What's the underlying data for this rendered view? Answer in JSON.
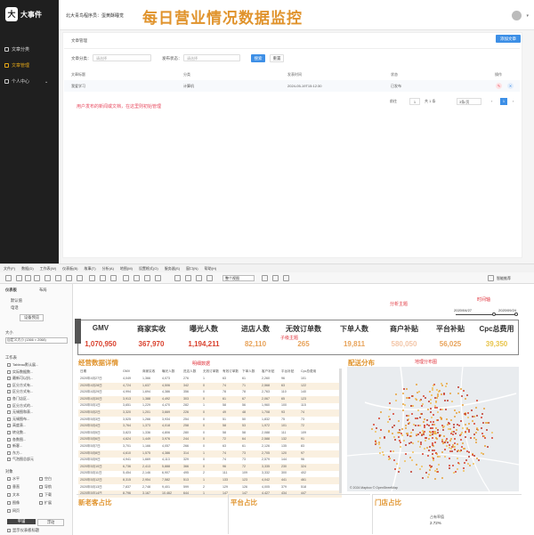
{
  "admin": {
    "logo_text": "大事件",
    "sidebar": [
      {
        "label": "文章分类"
      },
      {
        "label": "文章管理"
      },
      {
        "label": "个人中心"
      }
    ],
    "header_title": "北大青鸟程序员：蛋黄酥睡觉",
    "card_title": "文章管理",
    "add_button": "添加文章",
    "filter": {
      "category_label": "文章分类：",
      "category_placeholder": "请选择",
      "status_label": "发布状态：",
      "status_placeholder": "请选择",
      "search_button": "搜索",
      "reset_button": "重置"
    },
    "columns": [
      "文章标题",
      "分类",
      "发表时间",
      "状态",
      "操作"
    ],
    "rows": [
      {
        "title": "我爱学习",
        "category": "计算机",
        "time": "2024-05-19T15:12:30",
        "status": "已发布"
      }
    ],
    "note": "用户发布的新闻或文档，在这里则初始管理",
    "pagination": {
      "total": "共 1 条",
      "page_size": "3条/页",
      "jump_label": "前往",
      "page": "1",
      "current": "1"
    }
  },
  "tableau": {
    "menu": [
      "文件(F)",
      "数据(D)",
      "工作表(W)",
      "仪表板(B)",
      "故事(T)",
      "分析(A)",
      "地图(M)",
      "设置格式(O)",
      "服务器(S)",
      "窗口(N)",
      "帮助(H)"
    ],
    "toolbar_view": "整个视图",
    "smart_recommend": "智能推荐",
    "left": {
      "tab1": "仪表板",
      "tab2": "布局",
      "device_preview": "默认值",
      "device_sub": "电话",
      "device_button": "设备预览",
      "size_label": "大小",
      "size_value": "自定义大小 (1366 × 2068)",
      "sheets_label": "工作表",
      "sheets": [
        "Tableau默认展...",
        "实际数据数...",
        "最新可以抗...",
        "区分方式有...",
        "区分方式有...",
        "各门店区...",
        "区分方式的...",
        "无锡图和表...",
        "无锡图布...",
        "高度表...",
        "转化数...",
        "各数图...",
        "新客...",
        "东方...",
        "气泡图总部元"
      ],
      "objects_label": "对象",
      "objects": [
        "水平",
        "空白",
        "垂直",
        "导航",
        "文本",
        "下载",
        "图像",
        "扩展",
        "网页"
      ],
      "float_tab": "平铺",
      "float_tab2": "浮动",
      "show_title": "显示仪表板标题"
    },
    "title": "每日营业情况数据监控",
    "ann_title": "分析主题",
    "ann_time": "时间轴",
    "ann_sub": "子级主题",
    "ann_detail": "明细数据",
    "ann_map": "地理分布图",
    "date_from": "2020/04/27",
    "date_to": "2020/09/24",
    "kpis": [
      {
        "label": "GMV",
        "value": "1,070,950",
        "color": "#d9412e"
      },
      {
        "label": "商家实收",
        "value": "367,970",
        "color": "#d9412e"
      },
      {
        "label": "曝光人数",
        "value": "1,194,211",
        "color": "#d9412e"
      },
      {
        "label": "进店人数",
        "value": "82,110",
        "color": "#e8a35a"
      },
      {
        "label": "无效订单数",
        "value": "265",
        "color": "#e8a35a"
      },
      {
        "label": "下单人数",
        "value": "19,811",
        "color": "#e8a35a"
      },
      {
        "label": "商户补贴",
        "value": "580,050",
        "color": "#f3c6a8"
      },
      {
        "label": "平台补贴",
        "value": "56,025",
        "color": "#e8a35a"
      },
      {
        "label": "Cpc总费用",
        "value": "39,350",
        "color": "#e8c44a"
      }
    ],
    "detail_title": "经营数据详情",
    "map_title": "配送分布",
    "table_head": [
      "日期",
      "GMV",
      "商家实收",
      "曝光人数",
      "进店人数",
      "无效订单数",
      "有效订单数",
      "下单人数",
      "客户补贴",
      "平台补贴",
      "Cpc总费用"
    ],
    "table_rows": [
      [
        "2020年4月27日",
        "4,049",
        "1,366",
        "4,073",
        "276",
        "1",
        "63",
        "61",
        "2,260",
        "96",
        "101"
      ],
      [
        "2020年4月28日",
        "4,724",
        "1,637",
        "4,506",
        "342",
        "0",
        "74",
        "71",
        "2,568",
        "63",
        "122"
      ],
      [
        "2020年4月29日",
        "4,994",
        "1,694",
        "4,386",
        "356",
        "0",
        "78",
        "78",
        "2,763",
        "110",
        "140"
      ],
      [
        "2020年4月30日",
        "3,913",
        "1,388",
        "4,492",
        "303",
        "0",
        "61",
        "67",
        "2,067",
        "65",
        "123"
      ],
      [
        "2020年5月1日",
        "3,651",
        "1,229",
        "4,470",
        "282",
        "1",
        "58",
        "56",
        "1,960",
        "100",
        "115"
      ],
      [
        "2020年5月2日",
        "3,320",
        "1,201",
        "3,669",
        "226",
        "0",
        "49",
        "48",
        "1,708",
        "93",
        "74"
      ],
      [
        "2020年5月3日",
        "3,525",
        "1,266",
        "3,934",
        "254",
        "0",
        "51",
        "50",
        "1,832",
        "75",
        "73"
      ],
      [
        "2020年5月4日",
        "3,764",
        "1,373",
        "4,018",
        "258",
        "0",
        "58",
        "53",
        "1,972",
        "101",
        "72"
      ],
      [
        "2020年5月5日",
        "3,823",
        "1,336",
        "4,806",
        "280",
        "0",
        "58",
        "58",
        "2,088",
        "111",
        "109"
      ],
      [
        "2020年5月6日",
        "4,624",
        "1,449",
        "3,976",
        "244",
        "0",
        "72",
        "64",
        "2,588",
        "132",
        "91"
      ],
      [
        "2020年5月7日",
        "3,701",
        "1,166",
        "4,057",
        "266",
        "0",
        "63",
        "61",
        "2,126",
        "135",
        "83"
      ],
      [
        "2020年5月8日",
        "4,610",
        "1,575",
        "4,386",
        "314",
        "1",
        "74",
        "73",
        "2,705",
        "120",
        "97"
      ],
      [
        "2020年5月9日",
        "4,941",
        "1,669",
        "4,113",
        "329",
        "0",
        "74",
        "73",
        "2,579",
        "144",
        "96"
      ],
      [
        "2020年5月10日",
        "6,736",
        "2,413",
        "5,888",
        "366",
        "0",
        "96",
        "72",
        "3,335",
        "230",
        "324"
      ],
      [
        "2020年5月11日",
        "5,454",
        "2,146",
        "6,907",
        "495",
        "2",
        "111",
        "109",
        "3,332",
        "300",
        "402"
      ],
      [
        "2020年5月12日",
        "8,315",
        "2,954",
        "7,582",
        "513",
        "1",
        "133",
        "123",
        "4,042",
        "441",
        "461"
      ],
      [
        "2020年5月13日",
        "7,837",
        "2,748",
        "9,401",
        "599",
        "2",
        "129",
        "126",
        "4,005",
        "379",
        "518"
      ],
      [
        "2020年5月14日",
        "8,796",
        "3,167",
        "10,462",
        "644",
        "1",
        "147",
        "147",
        "4,427",
        "434",
        "447"
      ]
    ],
    "map_credit": "© 2024 Mapbox © OpenStreetMap",
    "bottom": [
      {
        "title": "新老客占比"
      },
      {
        "title": "平台占比"
      },
      {
        "title": "门店占比"
      }
    ],
    "store_value": "2.72%",
    "store_label": "占有率值"
  }
}
